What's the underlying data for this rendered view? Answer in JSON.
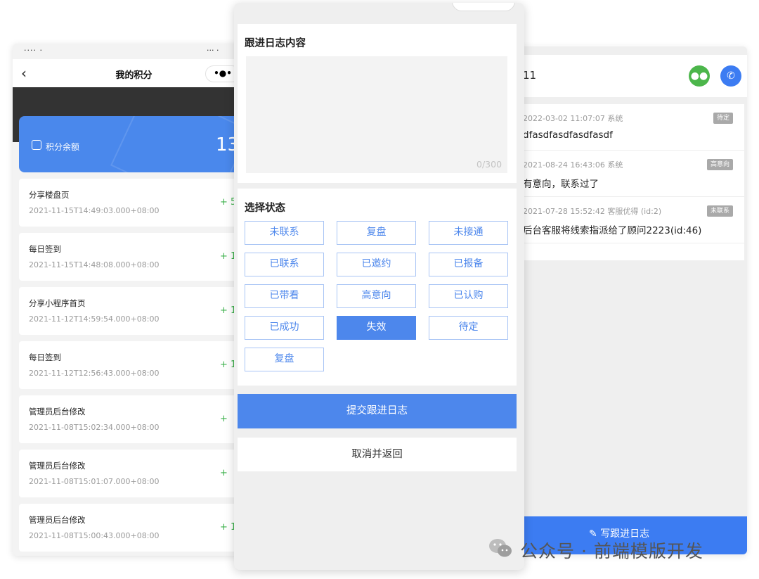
{
  "points_screen": {
    "status_left": "‧‧‧‧ ‧",
    "status_right": "‧‧‧ ‧",
    "back_icon": "chevron-left-icon",
    "title": "我的积分",
    "menu_capsule": "•●•",
    "balance_label": "积分余额",
    "balance_value": "13",
    "records": [
      {
        "title": "分享楼盘页",
        "time": "2021-11-15T14:49:03.000+08:00",
        "change": "+ 5"
      },
      {
        "title": "每日签到",
        "time": "2021-11-15T14:48:08.000+08:00",
        "change": "+ 1"
      },
      {
        "title": "分享小程序首页",
        "time": "2021-11-12T14:59:54.000+08:00",
        "change": "+ 1"
      },
      {
        "title": "每日签到",
        "time": "2021-11-12T12:56:43.000+08:00",
        "change": "+ 1"
      },
      {
        "title": "管理员后台修改",
        "time": "2021-11-08T15:02:34.000+08:00",
        "change": "+"
      },
      {
        "title": "管理员后台修改",
        "time": "2021-11-08T15:01:07.000+08:00",
        "change": "+"
      },
      {
        "title": "管理员后台修改",
        "time": "2021-11-08T15:00:43.000+08:00",
        "change": "+ 1"
      }
    ]
  },
  "followup_modal": {
    "log_section_title": "跟进日志内容",
    "log_counter": "0/300",
    "status_section_title": "选择状态",
    "statuses": [
      {
        "label": "未联系",
        "active": false
      },
      {
        "label": "复盘",
        "active": false
      },
      {
        "label": "未接通",
        "active": false
      },
      {
        "label": "已联系",
        "active": false
      },
      {
        "label": "已邀约",
        "active": false
      },
      {
        "label": "已报备",
        "active": false
      },
      {
        "label": "已带看",
        "active": false
      },
      {
        "label": "高意向",
        "active": false
      },
      {
        "label": "已认购",
        "active": false
      },
      {
        "label": "已成功",
        "active": false
      },
      {
        "label": "失效",
        "active": true
      },
      {
        "label": "待定",
        "active": false
      },
      {
        "label": "复盘",
        "active": false
      }
    ],
    "submit_label": "提交跟进日志",
    "cancel_label": "取消并返回",
    "accent_color": "#4d87ec"
  },
  "lead_screen": {
    "name": "11",
    "wechat_icon": "wechat-icon",
    "phone_icon": "phone-icon",
    "logs": [
      {
        "meta": "2022-03-02 11:07:07 系统",
        "text": "dfasdfasdfasdfasdf",
        "tag": "待定"
      },
      {
        "meta": "2021-08-24 16:43:06 系统",
        "text": "有意向，联系过了",
        "tag": "高意向"
      },
      {
        "meta": "2021-07-28 15:52:42 客服优得 (id:2)",
        "text": "后台客服将线索指派给了顾问2223(id:46)",
        "tag": "未联系"
      }
    ],
    "write_log_label": "写跟进日志",
    "accent_color": "#3c7cf2"
  },
  "watermark": {
    "icon": "wechat-icon",
    "text": "公众号 · 前端模版开发"
  }
}
